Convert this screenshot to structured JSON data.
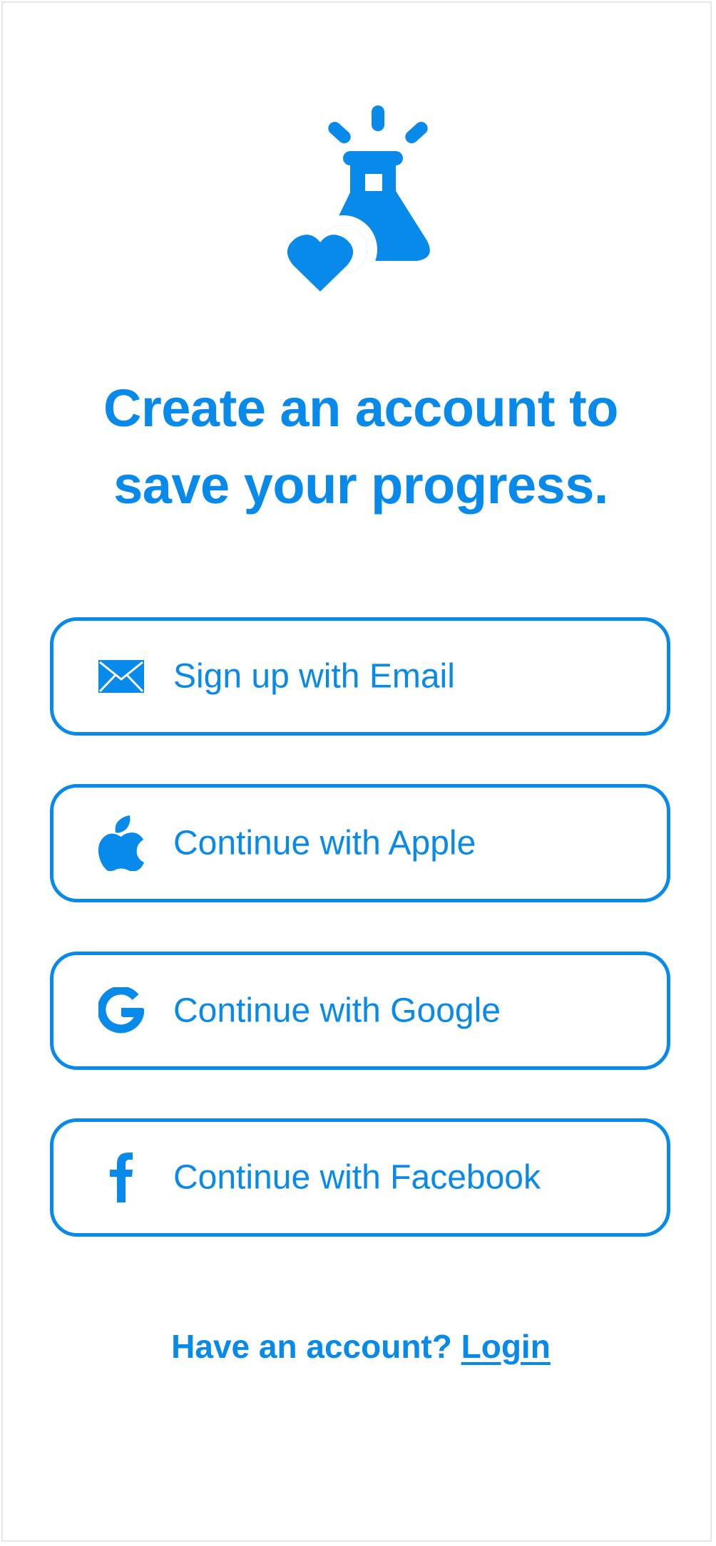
{
  "colors": {
    "accent": "#078ae9",
    "background": "#ffffff"
  },
  "logo": {
    "icon": "flask-heart-icon"
  },
  "heading": {
    "line1": "Create an account to",
    "line2": "save your progress."
  },
  "buttons": [
    {
      "icon": "email-icon",
      "label": "Sign up with Email"
    },
    {
      "icon": "apple-icon",
      "label": "Continue with Apple"
    },
    {
      "icon": "google-icon",
      "label": "Continue with Google"
    },
    {
      "icon": "facebook-icon",
      "label": "Continue with Facebook"
    }
  ],
  "footer": {
    "prompt": "Have an account?",
    "login_label": "Login"
  }
}
